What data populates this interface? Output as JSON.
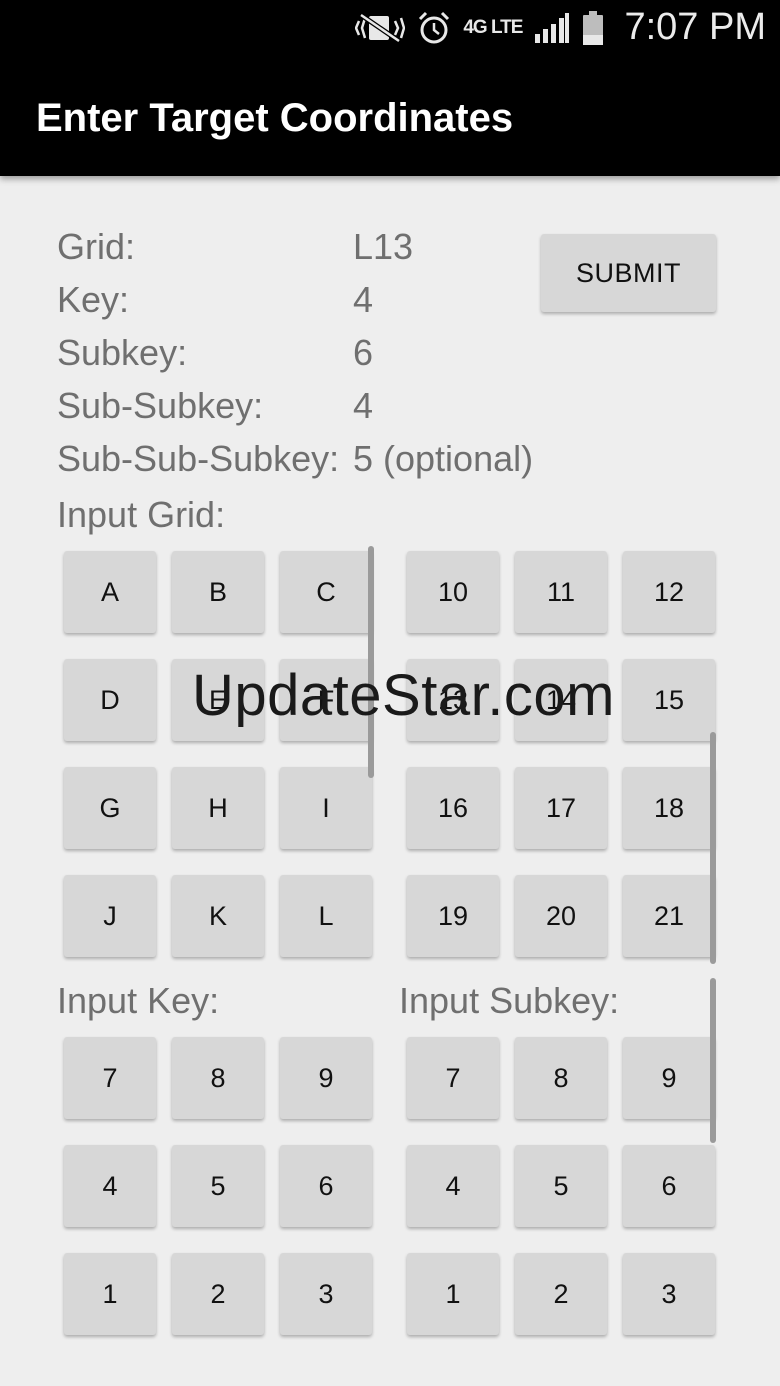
{
  "status_bar": {
    "time": "7:07 PM",
    "network": "4G LTE",
    "icons": [
      "vibrate-mute-icon",
      "alarm-icon",
      "lte-icon",
      "signal-icon",
      "battery-icon"
    ]
  },
  "app_bar": {
    "title": "Enter Target Coordinates"
  },
  "target": {
    "rows": [
      {
        "label": "Grid:",
        "value": "L13"
      },
      {
        "label": "Key:",
        "value": "4"
      },
      {
        "label": "Subkey:",
        "value": "6"
      },
      {
        "label": "Sub-Subkey:",
        "value": "4"
      },
      {
        "label": "Sub-Sub-Subkey:",
        "value": "5 (optional)"
      }
    ]
  },
  "submit_label": "SUBMIT",
  "input_grid": {
    "label": "Input Grid:",
    "letters": [
      "A",
      "B",
      "C",
      "D",
      "E",
      "F",
      "G",
      "H",
      "I",
      "J",
      "K",
      "L"
    ],
    "numbers": [
      "10",
      "11",
      "12",
      "13",
      "14",
      "15",
      "16",
      "17",
      "18",
      "19",
      "20",
      "21"
    ]
  },
  "input_key": {
    "label": "Input Key:",
    "keys": [
      "7",
      "8",
      "9",
      "4",
      "5",
      "6",
      "1",
      "2",
      "3"
    ]
  },
  "input_subkey": {
    "label": "Input Subkey:",
    "keys": [
      "7",
      "8",
      "9",
      "4",
      "5",
      "6",
      "1",
      "2",
      "3"
    ]
  },
  "watermark": "UpdateStar.com"
}
